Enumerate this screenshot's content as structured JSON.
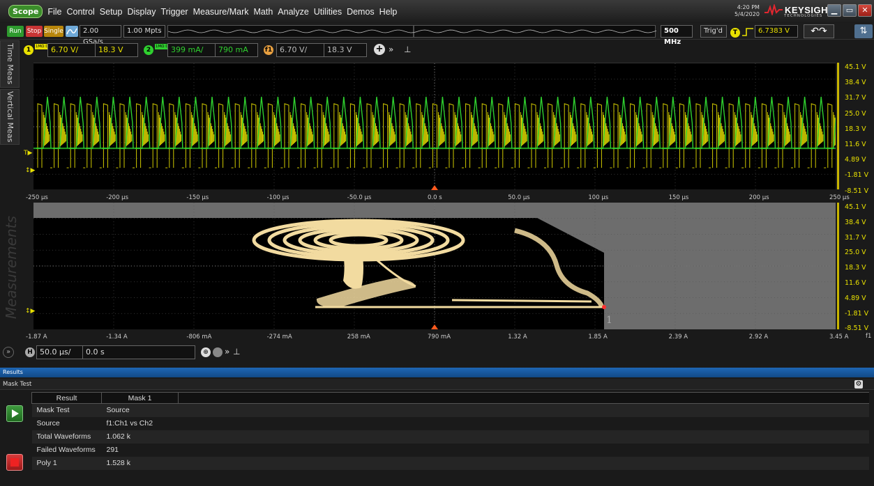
{
  "menu": {
    "logo": "Scope",
    "items": [
      "File",
      "Control",
      "Setup",
      "Display",
      "Trigger",
      "Measure/Mark",
      "Math",
      "Analyze",
      "Utilities",
      "Demos",
      "Help"
    ],
    "time": "4:20 PM",
    "date": "5/4/2020",
    "brand": "KEYSIGHT",
    "brand_sub": "TECHNOLOGIES"
  },
  "toolbar": {
    "run": "Run",
    "stop": "Stop",
    "single": "Single",
    "sample_rate": "2.00 GSa/s",
    "memory_depth": "1.00 Mpts",
    "bandwidth": "500 MHz",
    "trig_status": "Trig'd",
    "trigger_level": "6.7383 V"
  },
  "channels": {
    "ch1_scale": "6.70 V/",
    "ch1_offset": "18.3 V",
    "ch1_coupling": "1MΩ DC",
    "ch2_scale": "399 mA/",
    "ch2_offset": "790 mA",
    "ch2_coupling": "1MΩ DC",
    "f1_scale": "6.70 V/",
    "f1_offset": "18.3 V"
  },
  "side_tabs": [
    "Time Meas",
    "Vertical Meas"
  ],
  "measurements_watermark": "Measurements",
  "plot1": {
    "time_labels": [
      "-250 µs",
      "-200 µs",
      "-150 µs",
      "-100 µs",
      "-50.0 µs",
      "0.0 s",
      "50.0 µs",
      "100 µs",
      "150 µs",
      "200 µs",
      "250 µs"
    ],
    "volt_labels": [
      "45.1 V",
      "38.4 V",
      "31.7 V",
      "25.0 V",
      "18.3 V",
      "11.6 V",
      "4.89 V",
      "-1.81 V",
      "-8.51 V"
    ]
  },
  "plot2": {
    "current_labels": [
      "-1.87 A",
      "-1.34 A",
      "-806 mA",
      "-274 mA",
      "258 mA",
      "790 mA",
      "1.32 A",
      "1.85 A",
      "2.39 A",
      "2.92 A",
      "3.45 A"
    ],
    "volt_labels": [
      "45.1 V",
      "38.4 V",
      "31.7 V",
      "25.0 V",
      "18.3 V",
      "11.6 V",
      "4.89 V",
      "-1.81 V",
      "-8.51 V"
    ],
    "axis_tag": "f1",
    "marker_label": "1"
  },
  "horizontal": {
    "scale": "50.0 µs/",
    "position": "0.0 s"
  },
  "results": {
    "panel_title": "Results",
    "section_title": "Mask Test",
    "columns": [
      "Result",
      "Mask 1"
    ],
    "rows": [
      [
        "Mask Test",
        "Source"
      ],
      [
        "Source",
        "f1:Ch1 vs Ch2"
      ],
      [
        "Total Waveforms",
        "1.062 k"
      ],
      [
        "Failed Waveforms",
        "291"
      ],
      [
        "Poly 1",
        "1.528 k"
      ]
    ]
  },
  "colors": {
    "ch1": "#e8e000",
    "ch2": "#2fd02f",
    "xy_trace": "#f2dba0",
    "mask": "#6d6d6d",
    "results_header": "#1e66b4"
  }
}
